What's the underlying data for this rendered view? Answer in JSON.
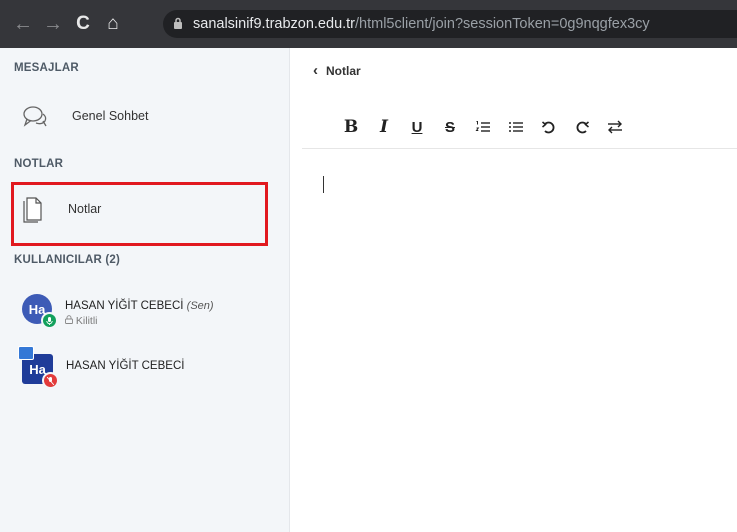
{
  "browser": {
    "url_domain": "sanalsinif9.trabzon.edu.tr",
    "url_path": "/html5client/join?sessionToken=0g9nqgfex3cy",
    "back_icon": "←",
    "forward_icon": "→",
    "reload_icon": "C",
    "home_icon": "⌂"
  },
  "sidebar": {
    "messages_title": "MESAJLAR",
    "public_chat_label": "Genel Sohbet",
    "notes_title": "NOTLAR",
    "notes_label": "Notlar",
    "users_title": "KULLANICILAR (2)",
    "users": [
      {
        "avatar": "Ha",
        "name": "HASAN YİĞİT CEBECİ",
        "you_tag": "(Sen)",
        "status": "Kilitli",
        "status_icon": "🔒"
      },
      {
        "avatar": "Ha",
        "name": "HASAN YİĞİT CEBECİ"
      }
    ]
  },
  "main": {
    "back_label": "Notlar",
    "back_icon": "‹",
    "toolbar": {
      "bold": "B",
      "italic": "I",
      "underline": "U",
      "strike": "S"
    }
  }
}
